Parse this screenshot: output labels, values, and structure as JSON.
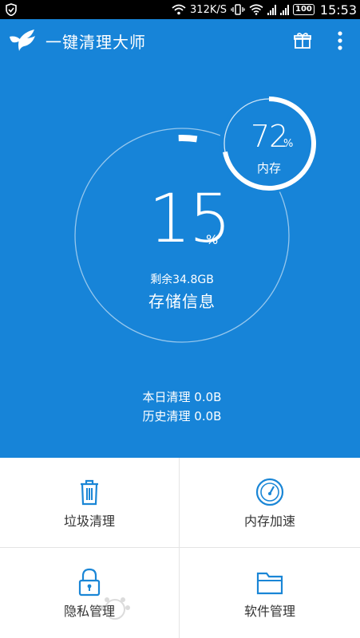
{
  "status_bar": {
    "net_speed": "312K/S",
    "battery": "100",
    "time": "15:53"
  },
  "app": {
    "title": "一键清理大师"
  },
  "memory": {
    "percent": "72",
    "unit": "%",
    "label": "内存",
    "fraction": 0.72
  },
  "storage": {
    "percent": "15",
    "unit": "%",
    "free": "剩余34.8GB",
    "label": "存储信息",
    "fraction": 0.15
  },
  "clean_stats": {
    "today": "本日清理 0.0B",
    "history": "历史清理 0.0B"
  },
  "tiles": [
    {
      "label": "垃圾清理",
      "icon": "trash-icon"
    },
    {
      "label": "内存加速",
      "icon": "speedometer-icon"
    },
    {
      "label": "隐私管理",
      "icon": "lock-icon"
    },
    {
      "label": "软件管理",
      "icon": "folder-icon"
    }
  ],
  "colors": {
    "primary_blue": "#1784d8",
    "tile_icon_blue": "#1a86d6",
    "tile_text": "#333333",
    "divider": "#e4e4e4"
  }
}
